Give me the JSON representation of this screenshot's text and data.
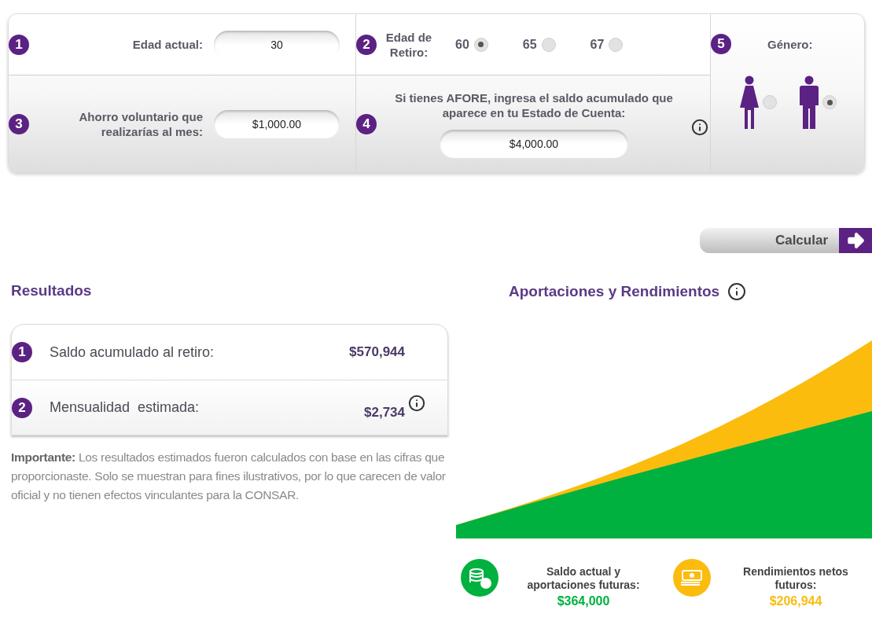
{
  "age": {
    "step": "1",
    "label": "Edad actual:",
    "value": "30"
  },
  "retirement": {
    "step": "2",
    "label": "Edad de Retiro:",
    "options": [
      {
        "label": "60",
        "selected": true
      },
      {
        "label": "65",
        "selected": false
      },
      {
        "label": "67",
        "selected": false
      }
    ]
  },
  "savings": {
    "step": "3",
    "label": "Ahorro voluntario que realizarías al mes:",
    "value": "$1,000.00"
  },
  "afore": {
    "step": "4",
    "label": "Si tienes AFORE, ingresa el saldo acumulado que aparece en tu Estado de Cuenta:",
    "value": "$4,000.00"
  },
  "gender": {
    "step": "5",
    "label": "Género:",
    "options": [
      {
        "kind": "female",
        "selected": false
      },
      {
        "kind": "male",
        "selected": true
      }
    ]
  },
  "calculate_button": "Calcular",
  "results": {
    "title": "Resultados",
    "rows": [
      {
        "step": "1",
        "label": "Saldo acumulado al retiro:",
        "value": "$570,944",
        "info": false
      },
      {
        "step": "2",
        "label": "Mensualidad  estimada:",
        "value": "$2,734",
        "info": true
      }
    ],
    "note": "**Importante:** Los resultados estimados fueron calculados con base en las cifras que proporcionaste. Solo se muestran para fines ilustrativos, por lo que carecen de valor oficial y no tienen efectos vinculantes para la CONSAR."
  },
  "chart": {
    "title": "Aportaciones y Rendimientos",
    "legend": [
      {
        "kind": "coins",
        "label": "Saldo actual y aportaciones futuras:",
        "value": "$364,000",
        "color": "#00b140"
      },
      {
        "kind": "bills",
        "label": "Rendimientos netos futuros:",
        "value": "$206,944",
        "color": "#fbbc0e"
      }
    ]
  }
}
